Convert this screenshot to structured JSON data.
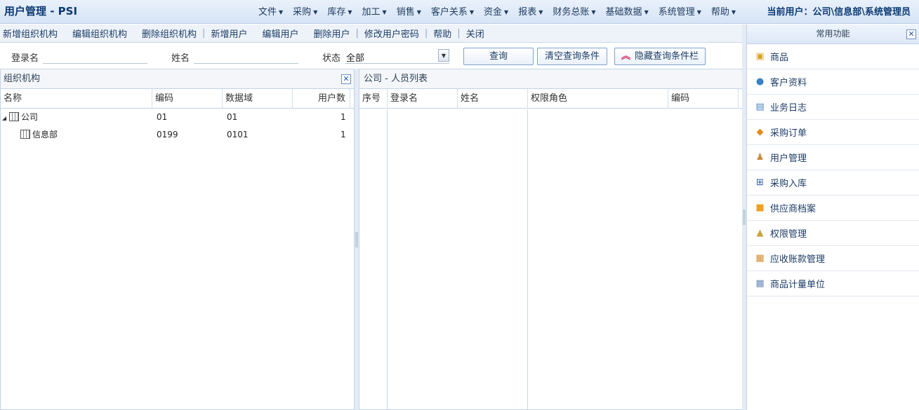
{
  "header": {
    "title": "用户管理 - PSI",
    "menus": [
      "文件",
      "采购",
      "库存",
      "加工",
      "销售",
      "客户关系",
      "资金",
      "报表",
      "财务总账",
      "基础数据",
      "系统管理",
      "帮助"
    ],
    "current_user": "当前用户：公司\\信息部\\系统管理员"
  },
  "toolbar": {
    "add_org": "新增组织机构",
    "edit_org": "编辑组织机构",
    "delete_org": "删除组织机构",
    "sep": "|",
    "add_user": "新增用户",
    "edit_user": "编辑用户",
    "delete_user": "删除用户",
    "change_password": "修改用户密码",
    "help": "帮助",
    "close": "关闭"
  },
  "query": {
    "login_label": "登录名",
    "login_value": "",
    "name_label": "姓名",
    "name_value": "",
    "status_label": "状态",
    "status_value": "全部",
    "search_button": "查询",
    "clear_button": "清空查询条件",
    "hide_button": "隐藏查询条件栏"
  },
  "org_panel": {
    "title": "组织机构",
    "columns": [
      "名称",
      "编码",
      "数据域",
      "用户数"
    ],
    "rows": [
      {
        "name": "公司",
        "code": "01",
        "domain": "01",
        "users": "1"
      },
      {
        "name": "信息部",
        "code": "0199",
        "domain": "0101",
        "users": "1"
      }
    ]
  },
  "user_panel": {
    "title": "公司 - 人员列表",
    "columns": [
      "序号",
      "登录名",
      "姓名",
      "权限角色",
      "编码"
    ]
  },
  "side": {
    "title": "常用功能",
    "items": [
      {
        "label": "商品",
        "icon": "goods-icon",
        "color": "#d9a326"
      },
      {
        "label": "客户资料",
        "icon": "customer-icon",
        "color": "#3b82c4"
      },
      {
        "label": "业务日志",
        "icon": "calendar-icon",
        "color": "#4a7fc1"
      },
      {
        "label": "采购订单",
        "icon": "purchase-order-icon",
        "color": "#e08a1e"
      },
      {
        "label": "用户管理",
        "icon": "user-management-icon",
        "color": "#c98a3a"
      },
      {
        "label": "采购入库",
        "icon": "stock-in-icon",
        "color": "#2a5da0"
      },
      {
        "label": "供应商档案",
        "icon": "supplier-box-icon",
        "color": "#f0a020"
      },
      {
        "label": "权限管理",
        "icon": "lock-icon",
        "color": "#c9a43a"
      },
      {
        "label": "应收账款管理",
        "icon": "receivable-icon",
        "color": "#d48a2a"
      },
      {
        "label": "商品计量单位",
        "icon": "unit-grid-icon",
        "color": "#6f8fb5"
      }
    ]
  }
}
